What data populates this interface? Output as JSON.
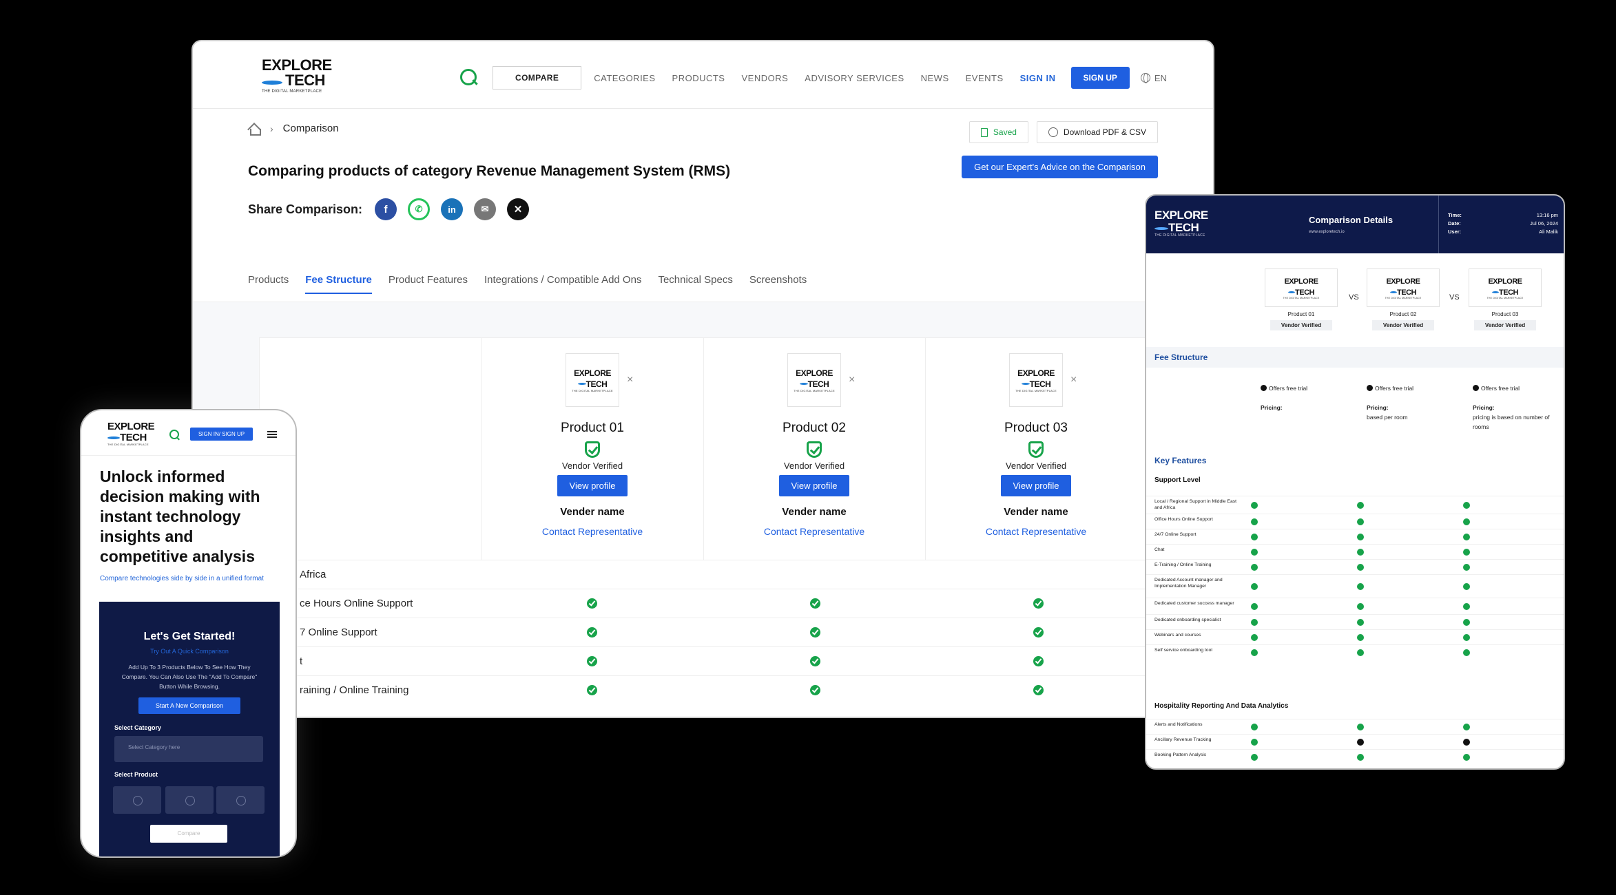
{
  "logo": {
    "line1": "EXPLORE",
    "line2": "TECH",
    "tagline": "THE DIGITAL MARKETPLACE"
  },
  "desktop": {
    "nav": {
      "compare": "COMPARE",
      "links": [
        "CATEGORIES",
        "PRODUCTS",
        "VENDORS",
        "ADVISORY SERVICES",
        "NEWS",
        "EVENTS"
      ],
      "sign_in": "SIGN IN",
      "sign_up": "SIGN UP",
      "lang": "EN"
    },
    "breadcrumb": "Comparison",
    "saved": "Saved",
    "download": "Download PDF & CSV",
    "expert": "Get our Expert's Advice on the Comparison",
    "title": "Comparing products of category Revenue Management System (RMS)",
    "share_label": "Share Comparison:",
    "share_icons": [
      "facebook-icon",
      "whatsapp-icon",
      "linkedin-icon",
      "email-icon",
      "x-icon"
    ],
    "tabs": [
      "Products",
      "Fee Structure",
      "Product Features",
      "Integrations / Compatible Add Ons",
      "Technical Specs",
      "Screenshots"
    ],
    "active_tab": "Fee Structure",
    "products": [
      {
        "name": "Product 01",
        "verified": "Vendor Verified",
        "view": "View profile",
        "vendor": "Vender name",
        "contact": "Contact Representative"
      },
      {
        "name": "Product 02",
        "verified": "Vendor Verified",
        "view": "View profile",
        "vendor": "Vender name",
        "contact": "Contact Representative"
      },
      {
        "name": "Product 03",
        "verified": "Vendor Verified",
        "view": "View profile",
        "vendor": "Vender name",
        "contact": "Contact Representative"
      }
    ],
    "close": "×",
    "features": [
      "Africa",
      "ce Hours Online Support",
      "7 Online Support",
      "t",
      "raining / Online Training"
    ]
  },
  "phone": {
    "sign": "SIGN IN/ SIGN UP",
    "hero": "Unlock informed decision making with instant technology insights and competitive analysis",
    "sub": "Compare technologies side by side in a unified format",
    "card_title": "Let's Get Started!",
    "card_sub": "Try Out A Quick Comparison",
    "card_desc": "Add Up To 3 Products Below To See How They Compare. You Can Also Use The \"Add To Compare\" Button While Browsing.",
    "new_btn": "Start A New Comparison",
    "sel_cat": "Select Category",
    "sel_cat_ph": "Select Category here",
    "sel_prod": "Select Product",
    "compare": "Compare"
  },
  "tablet": {
    "title": "Comparison Details",
    "url": "www.exploretech.io",
    "meta": [
      {
        "k": "Time:",
        "v": "13:16 pm"
      },
      {
        "k": "Date:",
        "v": "Jul 06, 2024"
      },
      {
        "k": "User:",
        "v": "Ali Malik"
      }
    ],
    "products": [
      "Product 01",
      "Product 02",
      "Product 03"
    ],
    "verified": "Vendor Verified",
    "vs": "VS",
    "fee_section": "Fee Structure",
    "fees": [
      {
        "trial": "Offers free trial",
        "pricing": "Pricing:",
        "detail": ""
      },
      {
        "trial": "Offers free trial",
        "pricing": "Pricing:",
        "detail": "based per room"
      },
      {
        "trial": "Offers free trial",
        "pricing": "Pricing:",
        "detail": "pricing is based on number of rooms"
      }
    ],
    "key_section": "Key Features",
    "support_label": "Support Level",
    "support_rows": [
      {
        "name": "Local / Regional Support in Middle East and Africa",
        "v": [
          1,
          1,
          1
        ]
      },
      {
        "name": "Office Hours Online Support",
        "v": [
          1,
          1,
          1
        ]
      },
      {
        "name": "24/7 Online Support",
        "v": [
          1,
          1,
          1
        ]
      },
      {
        "name": "Chat",
        "v": [
          1,
          1,
          1
        ]
      },
      {
        "name": "E-Training / Online Training",
        "v": [
          1,
          1,
          1
        ]
      },
      {
        "name": "Dedicated Account manager and Implementation Manager",
        "v": [
          1,
          1,
          1
        ]
      },
      {
        "name": "Dedicated customer success manager",
        "v": [
          1,
          1,
          1
        ]
      },
      {
        "name": "Dedicated onboarding specialist",
        "v": [
          1,
          1,
          1
        ]
      },
      {
        "name": "Webinars and courses",
        "v": [
          1,
          1,
          1
        ]
      },
      {
        "name": "Self service onboarding tool",
        "v": [
          1,
          1,
          1
        ]
      }
    ],
    "hosp_label": "Hospitality Reporting And Data Analytics",
    "hosp_rows": [
      {
        "name": "Alerts and Notifications",
        "v": [
          1,
          1,
          1
        ]
      },
      {
        "name": "Ancillary Revenue Tracking",
        "v": [
          1,
          0,
          0
        ]
      },
      {
        "name": "Booking Pattern Analysis",
        "v": [
          1,
          1,
          1
        ]
      }
    ]
  }
}
